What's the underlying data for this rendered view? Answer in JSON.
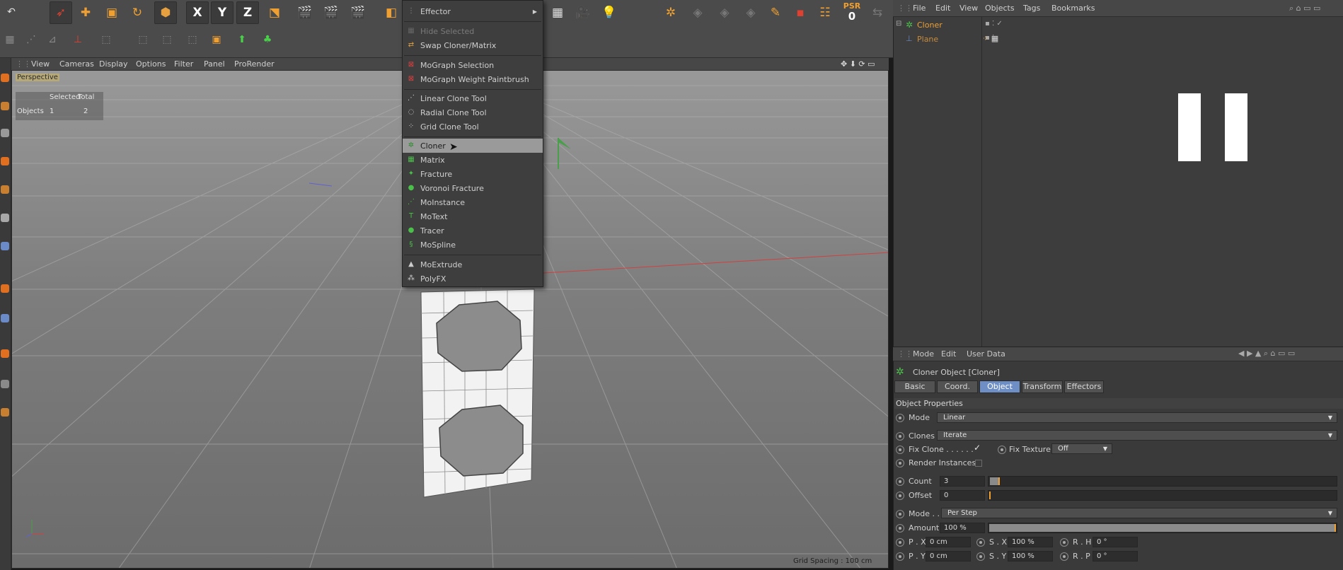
{
  "toolbar": {
    "icons": [
      "undo-icon",
      "cursor-icon",
      "move-icon",
      "scale-icon",
      "rotate-icon",
      "cube-icon",
      "x-axis-icon",
      "y-axis-icon",
      "z-axis-icon",
      "world-coord-icon",
      "render-view-icon",
      "render-picture-icon",
      "render-settings-icon",
      "cube-primitive-icon",
      "camera-icon",
      "light-icon"
    ],
    "axis_x": "X",
    "axis_y": "Y",
    "axis_z": "Z",
    "psr_label": "PSR",
    "psr_value": "0"
  },
  "viewport": {
    "menu": [
      "View",
      "Cameras",
      "Display",
      "Options",
      "Filter",
      "Panel",
      "ProRender"
    ],
    "camera_label": "Perspective",
    "hud": {
      "col1": "Selected",
      "col2": "Total",
      "row_label": "Objects",
      "selected": "1",
      "total": "2"
    },
    "grid_spacing": "Grid Spacing : 100 cm"
  },
  "dropdown": {
    "header": "Effector",
    "items": [
      {
        "label": "Hide Selected",
        "icon": "hide-selected-icon",
        "disabled": true
      },
      {
        "label": "Swap Cloner/Matrix",
        "icon": "swap-icon"
      },
      {
        "label": "MoGraph Selection",
        "icon": "mograph-selection-icon"
      },
      {
        "label": "MoGraph Weight Paintbrush",
        "icon": "paintbrush-icon"
      },
      {
        "label": "Linear Clone Tool",
        "icon": "linear-clone-icon"
      },
      {
        "label": "Radial Clone Tool",
        "icon": "radial-clone-icon"
      },
      {
        "label": "Grid Clone Tool",
        "icon": "grid-clone-icon"
      },
      {
        "label": "Cloner",
        "icon": "cloner-icon",
        "highlighted": true
      },
      {
        "label": "Matrix",
        "icon": "matrix-icon"
      },
      {
        "label": "Fracture",
        "icon": "fracture-icon"
      },
      {
        "label": "Voronoi Fracture",
        "icon": "voronoi-icon"
      },
      {
        "label": "MoInstance",
        "icon": "moinstance-icon"
      },
      {
        "label": "MoText",
        "icon": "motext-icon"
      },
      {
        "label": "Tracer",
        "icon": "tracer-icon"
      },
      {
        "label": "MoSpline",
        "icon": "mospline-icon"
      },
      {
        "label": "MoExtrude",
        "icon": "moextrude-icon"
      },
      {
        "label": "PolyFX",
        "icon": "polyfx-icon"
      }
    ]
  },
  "object_manager": {
    "menu": [
      "File",
      "Edit",
      "View",
      "Objects",
      "Tags",
      "Bookmarks"
    ],
    "objects": [
      {
        "name": "Cloner",
        "icon": "cloner-icon",
        "color": "#f0a030"
      },
      {
        "name": "Plane",
        "icon": "plane-icon",
        "color": "#d08a20"
      }
    ]
  },
  "attributes": {
    "menu": [
      "Mode",
      "Edit",
      "User Data"
    ],
    "title": "Cloner Object [Cloner]",
    "tabs": [
      "Basic",
      "Coord.",
      "Object",
      "Transform",
      "Effectors"
    ],
    "active_tab": "Object",
    "section": "Object Properties",
    "mode_label": "Mode",
    "mode_value": "Linear",
    "clones_label": "Clones",
    "clones_value": "Iterate",
    "fix_clone_label": "Fix Clone . . . . . .",
    "fix_texture_label": "Fix Texture",
    "fix_texture_value": "Off",
    "render_instances_label": "Render Instances",
    "count_label": "Count",
    "count_value": "3",
    "offset_label": "Offset",
    "offset_value": "0",
    "mode2_label": "Mode . .",
    "mode2_value": "Per Step",
    "amount_label": "Amount",
    "amount_value": "100 %",
    "amount_fraction": 1.0,
    "px_label": "P . X",
    "px_value": "0 cm",
    "sx_label": "S . X",
    "sx_value": "100 %",
    "rh_label": "R . H",
    "rh_value": "0 °",
    "py_label": "P . Y",
    "py_value": "0 cm",
    "sy_label": "S . Y",
    "sy_value": "100 %",
    "rp_label": "R . P",
    "rp_value": "0 °"
  },
  "colors": {
    "accent": "#6e8fc5",
    "highlight": "#9a9a9a",
    "orange": "#f0a030"
  }
}
